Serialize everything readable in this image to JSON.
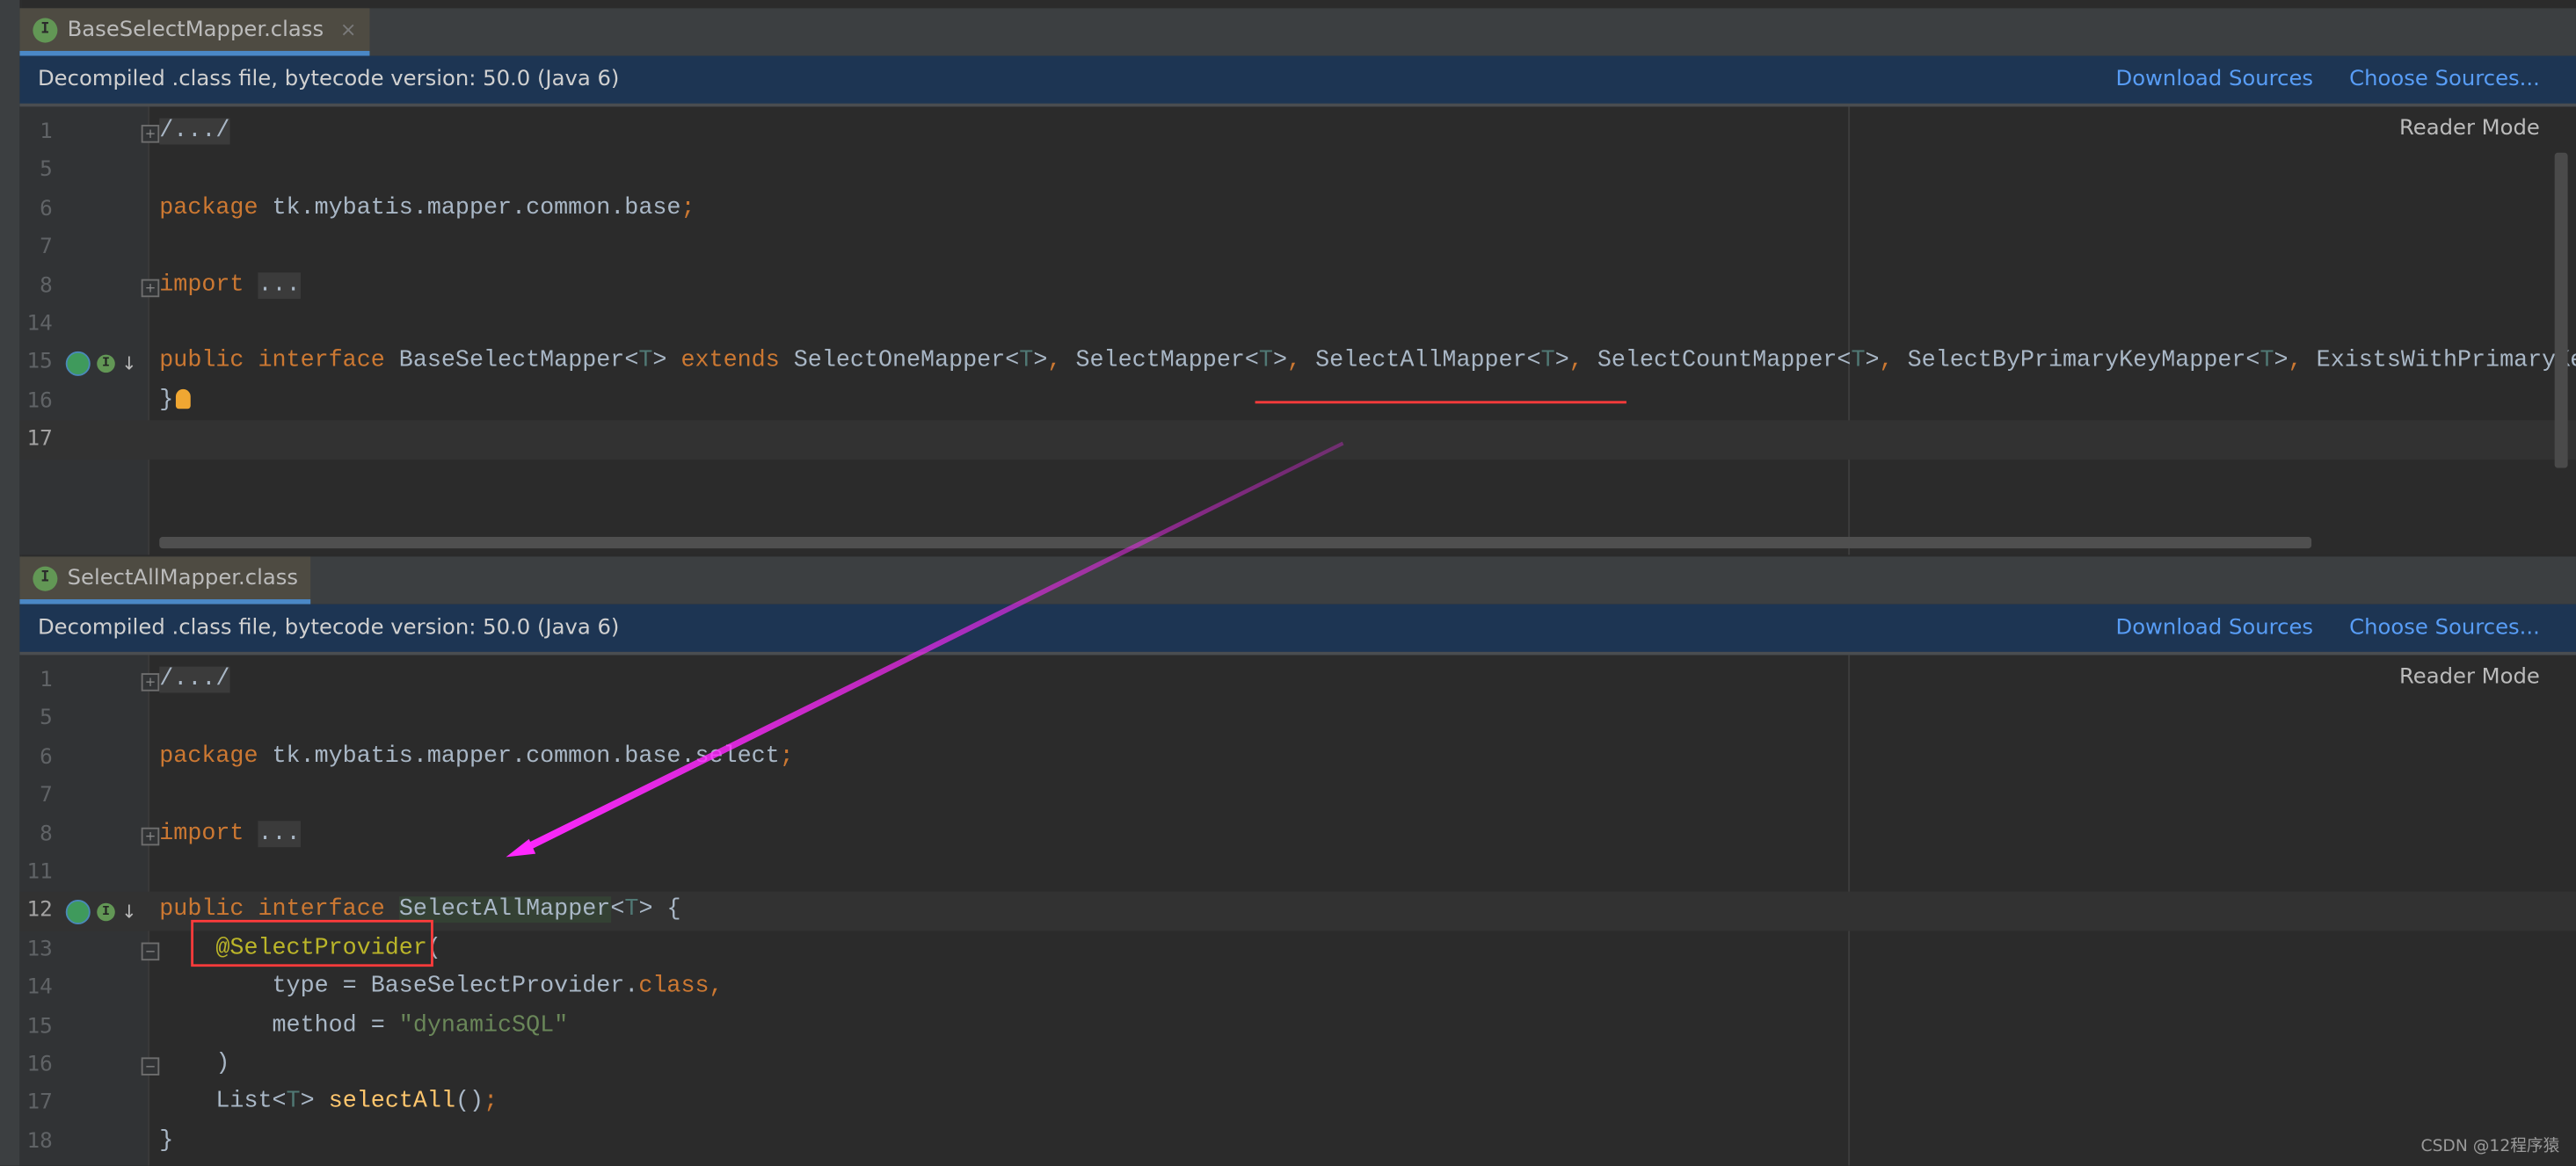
{
  "colors": {
    "keyword": "#cc7832",
    "text": "#a9b7c6",
    "type_param": "#507874",
    "string": "#6a8759",
    "annotation": "#bbb529",
    "method": "#ffc66d",
    "background": "#2b2b2b",
    "banner": "#1d3553",
    "link": "#589df6",
    "tab_underline": "#4a88c7",
    "annotation_red": "#ff3b3b",
    "arrow": "#ff28ff"
  },
  "panes": [
    {
      "tab": {
        "icon": "interface-icon",
        "label": "BaseSelectMapper.class",
        "close": "×"
      },
      "banner": {
        "message": "Decompiled .class file, bytecode version: 50.0 (Java 6)",
        "download": "Download Sources",
        "choose": "Choose Sources..."
      },
      "reader_mode": "Reader Mode",
      "lines": [
        {
          "n": "1",
          "fold": "+",
          "tokens": [
            [
              "/.../",
              "fold"
            ]
          ]
        },
        {
          "n": "5",
          "tokens": []
        },
        {
          "n": "6",
          "tokens": [
            [
              "package",
              "kw"
            ],
            [
              " tk.mybatis.mapper.common.base",
              ""
            ],
            [
              ";",
              "kw"
            ]
          ]
        },
        {
          "n": "7",
          "tokens": []
        },
        {
          "n": "8",
          "fold": "+",
          "tokens": [
            [
              "import",
              "kw"
            ],
            [
              " ",
              ""
            ],
            [
              "...",
              "fold"
            ]
          ]
        },
        {
          "n": "14",
          "tokens": []
        },
        {
          "n": "15",
          "gutter_icons": true,
          "tokens": [
            [
              "public interface",
              "kw"
            ],
            [
              " BaseSelectMapper<",
              ""
            ],
            [
              "T",
              "ty"
            ],
            [
              "> ",
              ""
            ],
            [
              "extends",
              "kw"
            ],
            [
              " SelectOneMapper<",
              ""
            ],
            [
              "T",
              "ty"
            ],
            [
              ">",
              ""
            ],
            [
              ",",
              "kw"
            ],
            [
              " SelectMapper<",
              ""
            ],
            [
              "T",
              "ty"
            ],
            [
              ">",
              ""
            ],
            [
              ",",
              "kw"
            ],
            [
              " SelectAllMapper<",
              ""
            ],
            [
              "T",
              "ty"
            ],
            [
              ">",
              ""
            ],
            [
              ",",
              "kw"
            ],
            [
              " SelectCountMapper<",
              ""
            ],
            [
              "T",
              "ty"
            ],
            [
              ">",
              ""
            ],
            [
              ",",
              "kw"
            ],
            [
              " SelectByPrimaryKeyMapper<",
              ""
            ],
            [
              "T",
              "ty"
            ],
            [
              ">",
              ""
            ],
            [
              ",",
              "kw"
            ],
            [
              " ExistsWithPrimaryKe",
              ""
            ]
          ]
        },
        {
          "n": "16",
          "bulb": true,
          "tokens": [
            [
              "}",
              ""
            ]
          ]
        },
        {
          "n": "17",
          "current": true,
          "tokens": []
        }
      ]
    },
    {
      "tab": {
        "icon": "interface-icon",
        "label": "SelectAllMapper.class"
      },
      "banner": {
        "message": "Decompiled .class file, bytecode version: 50.0 (Java 6)",
        "download": "Download Sources",
        "choose": "Choose Sources..."
      },
      "reader_mode": "Reader Mode",
      "lines": [
        {
          "n": "1",
          "fold": "+",
          "tokens": [
            [
              "/.../",
              "fold"
            ]
          ]
        },
        {
          "n": "5",
          "tokens": []
        },
        {
          "n": "6",
          "tokens": [
            [
              "package",
              "kw"
            ],
            [
              " tk.mybatis.mapper.common.base.select",
              ""
            ],
            [
              ";",
              "kw"
            ]
          ]
        },
        {
          "n": "7",
          "tokens": []
        },
        {
          "n": "8",
          "fold": "+",
          "tokens": [
            [
              "import",
              "kw"
            ],
            [
              " ",
              ""
            ],
            [
              "...",
              "fold"
            ]
          ]
        },
        {
          "n": "11",
          "tokens": []
        },
        {
          "n": "12",
          "current": true,
          "gutter_icons": true,
          "tokens": [
            [
              "public interface",
              "kw"
            ],
            [
              " ",
              ""
            ],
            [
              "SelectAllMapper",
              "hl"
            ],
            [
              "<",
              ""
            ],
            [
              "T",
              "ty"
            ],
            [
              "> {",
              ""
            ]
          ]
        },
        {
          "n": "13",
          "fold": "-",
          "tokens": [
            [
              "    ",
              ""
            ],
            [
              "@SelectProvider",
              "an"
            ],
            [
              "(",
              ""
            ]
          ]
        },
        {
          "n": "14",
          "tokens": [
            [
              "        type = BaseSelectProvider.",
              ""
            ],
            [
              "class",
              "kw"
            ],
            [
              ",",
              "kw"
            ]
          ]
        },
        {
          "n": "15",
          "tokens": [
            [
              "        method = ",
              ""
            ],
            [
              "\"dynamicSQL\"",
              "st"
            ]
          ]
        },
        {
          "n": "16",
          "fold": "-",
          "tokens": [
            [
              "    )",
              ""
            ]
          ]
        },
        {
          "n": "17",
          "tokens": [
            [
              "    List<",
              ""
            ],
            [
              "T",
              "ty"
            ],
            [
              "> ",
              ""
            ],
            [
              "selectAll",
              "mt"
            ],
            [
              "()",
              ""
            ],
            [
              ";",
              "kw"
            ]
          ]
        },
        {
          "n": "18",
          "tokens": [
            [
              "}",
              ""
            ]
          ]
        }
      ]
    }
  ],
  "watermark": "CSDN @12程序猿"
}
